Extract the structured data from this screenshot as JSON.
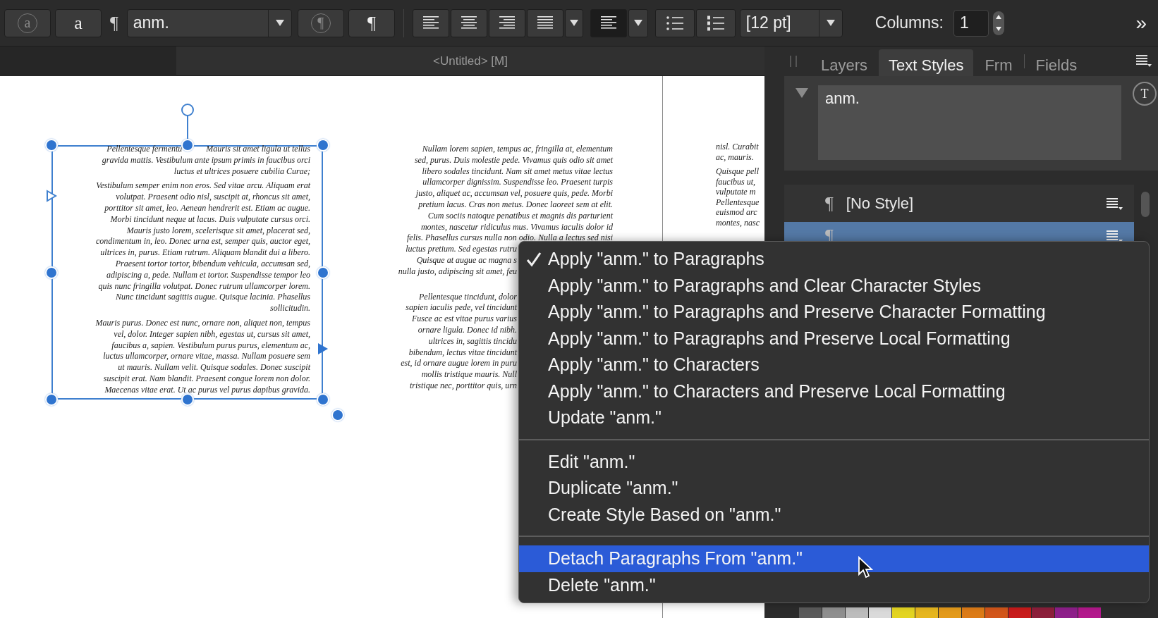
{
  "toolbar": {
    "char_style_buttons": [
      {
        "label": "a",
        "disabled": true
      },
      {
        "label": "a",
        "disabled": false
      }
    ],
    "pilcrow": "¶",
    "style_dropdown": {
      "value": "anm."
    },
    "para_style_buttons": [
      {
        "label": "¶",
        "disabled": true
      },
      {
        "label": "¶",
        "disabled": false
      }
    ],
    "size_dropdown": {
      "value": "[12 pt]"
    },
    "columns": {
      "label": "Columns:",
      "value": "1"
    },
    "overflow": "»"
  },
  "document_tab": {
    "title": "<Untitled> [M]"
  },
  "canvas": {
    "text_frame": {
      "first_line": [
        "Pellentesque fermentu",
        "Mauris sit amet ligula ut tellus"
      ],
      "paragraphs": [
        [
          "gravida mattis. Vestibulum ante ipsum primis in faucibus orci",
          "luctus et ultrices posuere cubilia Curae;"
        ],
        [
          "Vestibulum semper enim non eros. Sed vitae arcu. Aliquam erat",
          "volutpat. Praesent odio nisl, suscipit at, rhoncus sit amet,",
          "porttitor sit amet, leo. Aenean hendrerit est. Etiam ac augue.",
          "Morbi tincidunt neque ut lacus. Duis vulputate cursus orci.",
          "Mauris justo lorem, scelerisque sit amet, placerat sed,",
          "condimentum in, leo. Donec urna est, semper quis, auctor eget,",
          "ultrices in, purus. Etiam rutrum. Aliquam blandit dui a libero.",
          "Praesent tortor tortor, bibendum vehicula, accumsan sed,",
          "adipiscing a, pede. Nullam et tortor. Suspendisse tempor leo",
          "quis nunc fringilla volutpat. Donec rutrum ullamcorper lorem.",
          "Nunc tincidunt sagittis augue. Quisque lacinia. Phasellus",
          "sollicitudin."
        ],
        [
          "Mauris purus. Donec est nunc, ornare non, aliquet non, tempus",
          "vel, dolor. Integer sapien nibh, egestas ut, cursus sit amet,",
          "faucibus a, sapien. Vestibulum purus purus, elementum ac,",
          "luctus ullamcorper, ornare vitae, massa. Nullam posuere sem",
          "ut mauris. Nullam velit. Quisque sodales. Donec suscipit",
          "suscipit erat. Nam blandit. Praesent congue lorem non dolor.",
          "Maecenas vitae erat. Ut ac purus vel purus dapibus gravida."
        ]
      ]
    },
    "column_2": {
      "paragraphs": [
        {
          "lines": [
            "Nullam lorem sapien, tempus ac, fringilla at, elementum",
            "sed, purus. Duis molestie pede. Vivamus quis odio sit amet",
            "libero sodales tincidunt. Nam sit amet metus vitae lectus",
            "ullamcorper dignissim. Suspendisse leo. Praesent turpis",
            "justo, aliquet ac, accumsan vel, posuere quis, pede. Morbi",
            "pretium lacus. Cras non metus. Donec laoreet sem at elit.",
            "Cum sociis natoque penatibus et magnis dis parturient",
            "montes, nascetur ridiculus mus. Vivamus iaculis dolor id",
            "felis. Phasellus cursus nulla non odio. Nulla a lectus sed nisi"
          ],
          "cut_lines": [
            "luctus pretium. Sed egestas rutru",
            "Quisque at augue ac magna s",
            "nulla justo, adipiscing sit amet, feu"
          ]
        },
        {
          "cut_lines": [
            "Pellentesque tincidunt, dolor",
            "sapien iaculis pede, vel tincidunt",
            "Fusce ac est vitae purus varius",
            "ornare ligula. Donec id nibh.",
            "ultrices in, sagittis tincidu",
            "bibendum, lectus vitae tincidunt",
            "est, id ornare augue lorem in puru",
            "mollis tristique mauris. Null",
            "tristique nec, porttitor quis, urn"
          ]
        }
      ]
    },
    "column_3": {
      "paragraphs": [
        [
          "nisl. Curabit",
          "ac, mauris."
        ],
        [
          "Quisque pell",
          "faucibus ut,",
          "vulputate m",
          "Pellentesque",
          "euismod arc",
          "montes, nasc"
        ]
      ]
    }
  },
  "panel": {
    "tabs": [
      {
        "label": "Layers",
        "selected": false
      },
      {
        "label": "Text Styles",
        "selected": true
      },
      {
        "label": "Frm",
        "selected": false
      },
      {
        "label": "Fields",
        "selected": false
      }
    ],
    "preview": {
      "text": "anm.",
      "style_icon": "T"
    },
    "styles": [
      {
        "icon": "¶",
        "name": "[No Style]",
        "selected": false
      },
      {
        "icon": "¶",
        "selected": true
      }
    ],
    "swatches": [
      {
        "color": "#5b5b5b"
      },
      {
        "color": "#8f8f8f"
      },
      {
        "color": "#bcbcbc"
      },
      {
        "color": "#dadada"
      },
      {
        "color": "#e3d422"
      },
      {
        "color": "#e6b61f"
      },
      {
        "color": "#e39a1b"
      },
      {
        "color": "#dc7b17"
      },
      {
        "color": "#d2561a"
      },
      {
        "color": "#c81b1b"
      },
      {
        "color": "#8c1f3b"
      },
      {
        "color": "#8e1f8a"
      },
      {
        "color": "#b3188c"
      }
    ]
  },
  "context_menu": {
    "groups": [
      [
        {
          "label": "Apply \"anm.\" to Paragraphs",
          "checked": true,
          "selected": false
        },
        {
          "label": "Apply \"anm.\" to Paragraphs and Clear Character Styles",
          "checked": false,
          "selected": false
        },
        {
          "label": "Apply \"anm.\" to Paragraphs and Preserve Character Formatting",
          "checked": false,
          "selected": false
        },
        {
          "label": "Apply \"anm.\" to Paragraphs and Preserve Local Formatting",
          "checked": false,
          "selected": false
        },
        {
          "label": "Apply \"anm.\" to Characters",
          "checked": false,
          "selected": false
        },
        {
          "label": "Apply \"anm.\" to Characters and Preserve Local Formatting",
          "checked": false,
          "selected": false
        },
        {
          "label": "Update \"anm.\"",
          "checked": false,
          "selected": false
        }
      ],
      [
        {
          "label": "Edit \"anm.\"",
          "checked": false,
          "selected": false
        },
        {
          "label": "Duplicate \"anm.\"",
          "checked": false,
          "selected": false
        },
        {
          "label": "Create Style Based on \"anm.\"",
          "checked": false,
          "selected": false
        }
      ],
      [
        {
          "label": "Detach Paragraphs From \"anm.\"",
          "checked": false,
          "selected": true
        },
        {
          "label": "Delete \"anm.\"",
          "checked": false,
          "selected": false
        }
      ]
    ]
  }
}
